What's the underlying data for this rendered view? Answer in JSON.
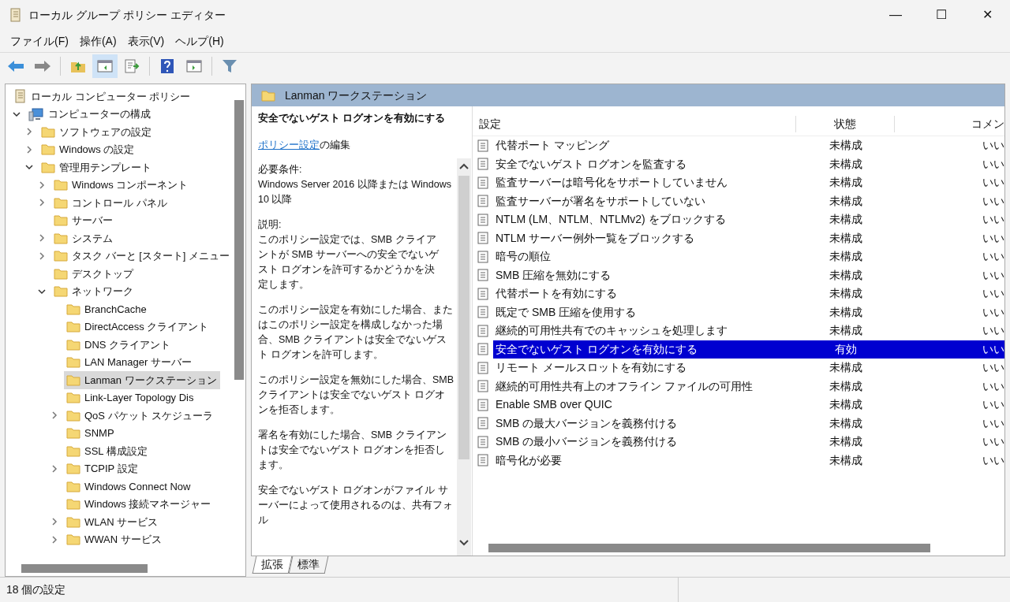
{
  "window": {
    "title": "ローカル グループ ポリシー エディター",
    "controls": [
      "—",
      "☐",
      "✕"
    ]
  },
  "menu": [
    "ファイル(F)",
    "操作(A)",
    "表示(V)",
    "ヘルプ(H)"
  ],
  "toolbar": [
    {
      "kind": "back",
      "selected": false
    },
    {
      "kind": "forward",
      "selected": false
    },
    {
      "kind": "up",
      "selected": false
    },
    {
      "kind": "tree",
      "selected": true
    },
    {
      "kind": "export",
      "selected": false
    },
    {
      "kind": "help",
      "selected": false
    },
    {
      "kind": "panel",
      "selected": false
    },
    {
      "kind": "filter",
      "selected": false
    }
  ],
  "tree": [
    {
      "label": "ローカル コンピューター ポリシー",
      "selected": false,
      "children": [
        {
          "label": "コンピューターの構成",
          "expandable": true,
          "expanded": true,
          "selected": false,
          "children": [
            {
              "label": "ソフトウェアの設定",
              "expandable": true,
              "expanded": false,
              "selected": false
            },
            {
              "label": "Windows の設定",
              "expandable": true,
              "expanded": false,
              "selected": false
            },
            {
              "label": "管理用テンプレート",
              "expandable": true,
              "expanded": true,
              "selected": false,
              "children": [
                {
                  "label": "Windows コンポーネント",
                  "expandable": true,
                  "expanded": false,
                  "selected": false
                },
                {
                  "label": "コントロール パネル",
                  "expandable": true,
                  "expanded": false,
                  "selected": false
                },
                {
                  "label": "サーバー",
                  "expandable": false,
                  "expanded": false,
                  "selected": false
                },
                {
                  "label": "システム",
                  "expandable": true,
                  "expanded": false,
                  "selected": false
                },
                {
                  "label": "タスク バーと [スタート] メニュー",
                  "expandable": true,
                  "expanded": false,
                  "selected": false
                },
                {
                  "label": "デスクトップ",
                  "expandable": false,
                  "expanded": false,
                  "selected": false
                },
                {
                  "label": "ネットワーク",
                  "expandable": true,
                  "expanded": true,
                  "selected": false,
                  "children": [
                    {
                      "label": "BranchCache",
                      "expandable": false,
                      "expanded": false,
                      "selected": false
                    },
                    {
                      "label": "DirectAccess クライアント",
                      "expandable": false,
                      "expanded": false,
                      "selected": false
                    },
                    {
                      "label": "DNS クライアント",
                      "expandable": false,
                      "expanded": false,
                      "selected": false
                    },
                    {
                      "label": "LAN Manager サーバー",
                      "expandable": false,
                      "expanded": false,
                      "selected": false
                    },
                    {
                      "label": "Lanman ワークステーション",
                      "expandable": false,
                      "expanded": false,
                      "selected": true
                    },
                    {
                      "label": "Link-Layer Topology Dis",
                      "expandable": false,
                      "expanded": false,
                      "selected": false
                    },
                    {
                      "label": "QoS パケット スケジューラ",
                      "expandable": true,
                      "expanded": false,
                      "selected": false
                    },
                    {
                      "label": "SNMP",
                      "expandable": false,
                      "expanded": false,
                      "selected": false
                    },
                    {
                      "label": "SSL 構成設定",
                      "expandable": false,
                      "expanded": false,
                      "selected": false
                    },
                    {
                      "label": "TCPIP 設定",
                      "expandable": true,
                      "expanded": false,
                      "selected": false
                    },
                    {
                      "label": "Windows Connect Now",
                      "expandable": false,
                      "expanded": false,
                      "selected": false
                    },
                    {
                      "label": "Windows 接続マネージャー",
                      "expandable": false,
                      "expanded": false,
                      "selected": false
                    },
                    {
                      "label": "WLAN サービス",
                      "expandable": true,
                      "expanded": false,
                      "selected": false
                    },
                    {
                      "label": "WWAN サービス",
                      "expandable": true,
                      "expanded": false,
                      "selected": false
                    }
                  ]
                }
              ]
            }
          ]
        }
      ]
    }
  ],
  "detail": {
    "header": "Lanman ワークステーション",
    "title": "安全でないゲスト ログオンを有効にする",
    "link": "ポリシー設定",
    "link_suffix": "の編集",
    "paragraphs": [
      "必要条件:\nWindows Server 2016 以降または Windows 10 以降",
      "説明:\nこのポリシー設定では、SMB クライアントが SMB サーバーへの安全でないゲスト ログオンを許可するかどうかを決定します。",
      "このポリシー設定を有効にした場合、またはこのポリシー設定を構成しなかった場合、SMB クライアントは安全でないゲスト ログオンを許可します。",
      "このポリシー設定を無効にした場合、SMB クライアントは安全でないゲスト ログオンを拒否します。",
      "署名を有効にした場合、SMB クライアントは安全でないゲスト ログオンを拒否します。",
      "安全でないゲスト ログオンがファイル サーバーによって使用されるのは、共有フォル"
    ],
    "tabs": [
      {
        "label": "拡張",
        "selected": true
      },
      {
        "label": "標準",
        "selected": false
      }
    ]
  },
  "table": {
    "columns": [
      "設定",
      "状態",
      "コメン"
    ],
    "rows": [
      {
        "name": "代替ポート マッピング",
        "state": "未構成",
        "comment": "いい",
        "selected": false
      },
      {
        "name": "安全でないゲスト ログオンを監査する",
        "state": "未構成",
        "comment": "いい",
        "selected": false
      },
      {
        "name": "監査サーバーは暗号化をサポートしていません",
        "state": "未構成",
        "comment": "いい",
        "selected": false
      },
      {
        "name": "監査サーバーが署名をサポートしていない",
        "state": "未構成",
        "comment": "いい",
        "selected": false
      },
      {
        "name": "NTLM (LM、NTLM、NTLMv2) をブロックする",
        "state": "未構成",
        "comment": "いい",
        "selected": false
      },
      {
        "name": "NTLM サーバー例外一覧をブロックする",
        "state": "未構成",
        "comment": "いい",
        "selected": false
      },
      {
        "name": "暗号の順位",
        "state": "未構成",
        "comment": "いい",
        "selected": false
      },
      {
        "name": "SMB 圧縮を無効にする",
        "state": "未構成",
        "comment": "いい",
        "selected": false
      },
      {
        "name": "代替ポートを有効にする",
        "state": "未構成",
        "comment": "いい",
        "selected": false
      },
      {
        "name": "既定で SMB 圧縮を使用する",
        "state": "未構成",
        "comment": "いい",
        "selected": false
      },
      {
        "name": "継続的可用性共有でのキャッシュを処理します",
        "state": "未構成",
        "comment": "いい",
        "selected": false
      },
      {
        "name": "安全でないゲスト ログオンを有効にする",
        "state": "有効",
        "comment": "いい",
        "selected": true
      },
      {
        "name": "リモート メールスロットを有効にする",
        "state": "未構成",
        "comment": "いい",
        "selected": false
      },
      {
        "name": "継続的可用性共有上のオフライン ファイルの可用性",
        "state": "未構成",
        "comment": "いい",
        "selected": false
      },
      {
        "name": "Enable SMB over QUIC",
        "state": "未構成",
        "comment": "いい",
        "selected": false
      },
      {
        "name": "SMB の最大バージョンを義務付ける",
        "state": "未構成",
        "comment": "いい",
        "selected": false
      },
      {
        "name": "SMB の最小バージョンを義務付ける",
        "state": "未構成",
        "comment": "いい",
        "selected": false
      },
      {
        "name": "暗号化が必要",
        "state": "未構成",
        "comment": "いい",
        "selected": false
      }
    ]
  },
  "status_bar": "18 個の設定"
}
